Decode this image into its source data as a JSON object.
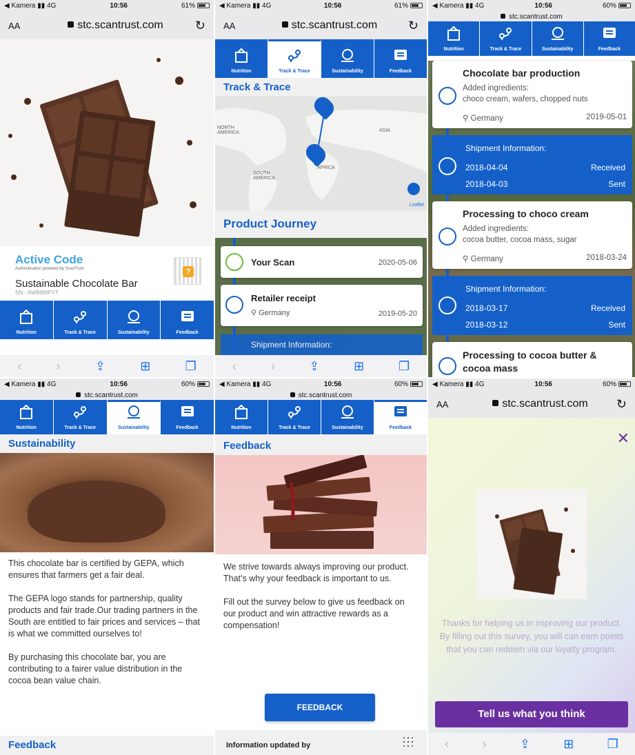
{
  "status": {
    "carrier": "◀ Kamera",
    "network": "4G",
    "time": "10:56",
    "battery_p1": "61%",
    "battery_other": "60%",
    "battery_p1_level": 0.61,
    "battery_other_level": 0.6
  },
  "browser": {
    "aa": "AA",
    "url": "stc.scantrust.com"
  },
  "tabs": [
    "Nutrition",
    "Track & Trace",
    "Sustainability",
    "Feedback"
  ],
  "product": {
    "active_code": "Active Code",
    "powered_by": "Authentication powered by ScanTrust",
    "name": "Sustainable Chocolate Bar",
    "sn": "SN - AWB9WFYT"
  },
  "track": {
    "title": "Track & Trace",
    "map_labels": [
      "NORTH AMERICA",
      "SOUTH AMERICA",
      "AFRICA",
      "ASIA"
    ],
    "leaflet": "Leaflet",
    "journey_title": "Product Journey",
    "your_scan": "Your Scan",
    "your_scan_date": "2020-05-06",
    "retailer": "Retailer receipt",
    "retailer_loc": "Germany",
    "retailer_date": "2019-05-20",
    "shipment_info_partial": "Shipment Information:"
  },
  "journey": {
    "step1_title": "Chocolate bar production",
    "step1_added": "Added ingredients:",
    "step1_ingredients": "choco cream, wafers, chopped nuts",
    "step1_loc": "Germany",
    "step1_date": "2019-05-01",
    "ship1_title": "Shipment Information:",
    "ship1_d1": "2018-04-04",
    "ship1_s1": "Received",
    "ship1_d2": "2018-04-03",
    "ship1_s2": "Sent",
    "step2_title": "Processing to choco cream",
    "step2_added": "Added ingredients:",
    "step2_ingredients": "cocoa butter, cocoa mass, sugar",
    "step2_loc": "Germany",
    "step2_date": "2018-03-24",
    "ship2_title": "Shipment Information:",
    "ship2_d1": "2018-03-17",
    "ship2_s1": "Received",
    "ship2_d2": "2018-03-12",
    "ship2_s2": "Sent",
    "step3_title": "Processing to cocoa butter & cocoa mass"
  },
  "sustain": {
    "title": "Sustainability",
    "p1": "This chocolate bar is certified by GEPA, which ensures that farmers get a fair deal.",
    "p2": "The GEPA logo stands for partnership, quality products and fair trade.Our trading partners in the South are entitled to fair prices and services – that is what we committed ourselves to!",
    "p3": "By purchasing this chocolate bar, you are contributing to a fairer value distribution in the cocoa bean value chain.",
    "next_title": "Feedback"
  },
  "feedback": {
    "title": "Feedback",
    "p1": "We strive towards always improving our product. That’s why your feedback is important to us.",
    "p2": "Fill out the survey below to give us feedback on our product and win attractive rewards as a compensation!",
    "button": "FEEDBACK",
    "info_updated": "Information updated by"
  },
  "survey": {
    "text": "Thanks for helping us in improving our product. By filling out this survey, you will can earn points that you can redeem via our loyalty program.",
    "button": "Tell us what you think"
  },
  "colors": {
    "brand_blue": "#1460c8",
    "survey_purple": "#6a2fa0",
    "accent_light_blue": "#3aa3e3"
  }
}
